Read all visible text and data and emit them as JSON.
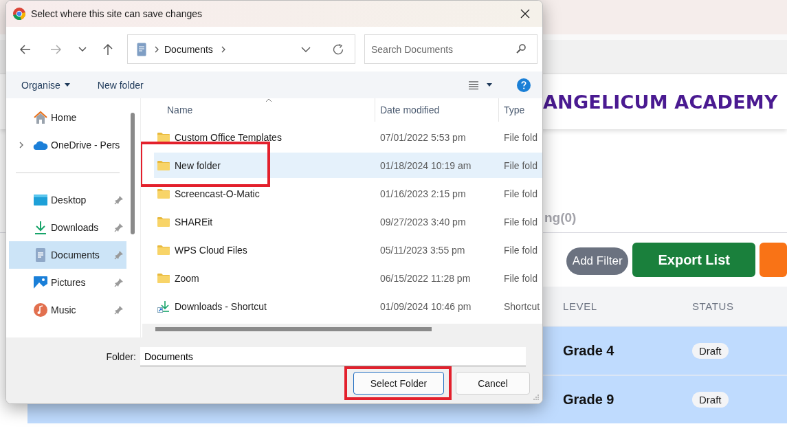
{
  "site": {
    "title": "ANGELICUM ACADEMY",
    "tab_label": "ng(0)",
    "actions": [
      {
        "label": "Add Filter",
        "kind": "filter"
      },
      {
        "label": "Export List",
        "kind": "export"
      },
      {
        "kind": "more"
      }
    ],
    "table": {
      "columns": [
        "LEVEL",
        "STATUS"
      ],
      "rows": [
        {
          "level": "Grade 4",
          "status": "Draft",
          "selected": true
        },
        {
          "level": "Grade 9",
          "status": "Draft",
          "selected": true
        }
      ]
    }
  },
  "dialog": {
    "title": "Select where this site can save changes",
    "address": {
      "segments": [
        "Documents"
      ]
    },
    "search": {
      "placeholder": "Search Documents"
    },
    "toolbar": {
      "items": [
        {
          "label": "Organise",
          "kind": "menu"
        },
        {
          "label": "New folder",
          "kind": "action"
        }
      ]
    },
    "sidebar": {
      "groups": [
        [
          {
            "label": "Home",
            "kind": "home",
            "expandable": false,
            "pinned": false,
            "selected": false
          },
          {
            "label": "OneDrive - Pers",
            "kind": "cloud",
            "expandable": true,
            "pinned": false,
            "selected": false
          }
        ],
        [
          {
            "label": "Desktop",
            "kind": "desktop",
            "expandable": false,
            "pinned": true,
            "selected": false
          },
          {
            "label": "Downloads",
            "kind": "downloads",
            "expandable": false,
            "pinned": true,
            "selected": false
          },
          {
            "label": "Documents",
            "kind": "documents",
            "expandable": false,
            "pinned": true,
            "selected": true
          },
          {
            "label": "Pictures",
            "kind": "pictures",
            "expandable": false,
            "pinned": true,
            "selected": false
          },
          {
            "label": "Music",
            "kind": "music",
            "expandable": false,
            "pinned": true,
            "selected": false
          }
        ]
      ]
    },
    "columns": [
      "Name",
      "Date modified",
      "Type"
    ],
    "files": [
      {
        "name": "Custom Office Templates",
        "date": "07/01/2022 5:53 pm",
        "type": "File fold",
        "kind": "folder",
        "selected": false,
        "highlighted": false
      },
      {
        "name": "New folder",
        "date": "01/18/2024 10:19 am",
        "type": "File fold",
        "kind": "folder",
        "selected": true,
        "highlighted": true
      },
      {
        "name": "Screencast-O-Matic",
        "date": "01/16/2023 2:15 pm",
        "type": "File fold",
        "kind": "folder",
        "selected": false,
        "highlighted": false
      },
      {
        "name": "SHAREit",
        "date": "09/27/2023 3:40 pm",
        "type": "File fold",
        "kind": "folder",
        "selected": false,
        "highlighted": false
      },
      {
        "name": "WPS Cloud Files",
        "date": "05/11/2023 3:55 pm",
        "type": "File fold",
        "kind": "folder",
        "selected": false,
        "highlighted": false
      },
      {
        "name": "Zoom",
        "date": "06/15/2022 11:28 pm",
        "type": "File fold",
        "kind": "folder",
        "selected": false,
        "highlighted": false
      },
      {
        "name": "Downloads - Shortcut",
        "date": "01/09/2024 10:46 pm",
        "type": "Shortcut",
        "kind": "shortcut",
        "selected": false,
        "highlighted": false
      }
    ],
    "folder_field": {
      "label": "Folder:",
      "value": "Documents"
    },
    "buttons": [
      {
        "label": "Select Folder",
        "kind": "primary",
        "highlighted": true
      },
      {
        "label": "Cancel",
        "kind": "secondary",
        "highlighted": false
      }
    ]
  }
}
